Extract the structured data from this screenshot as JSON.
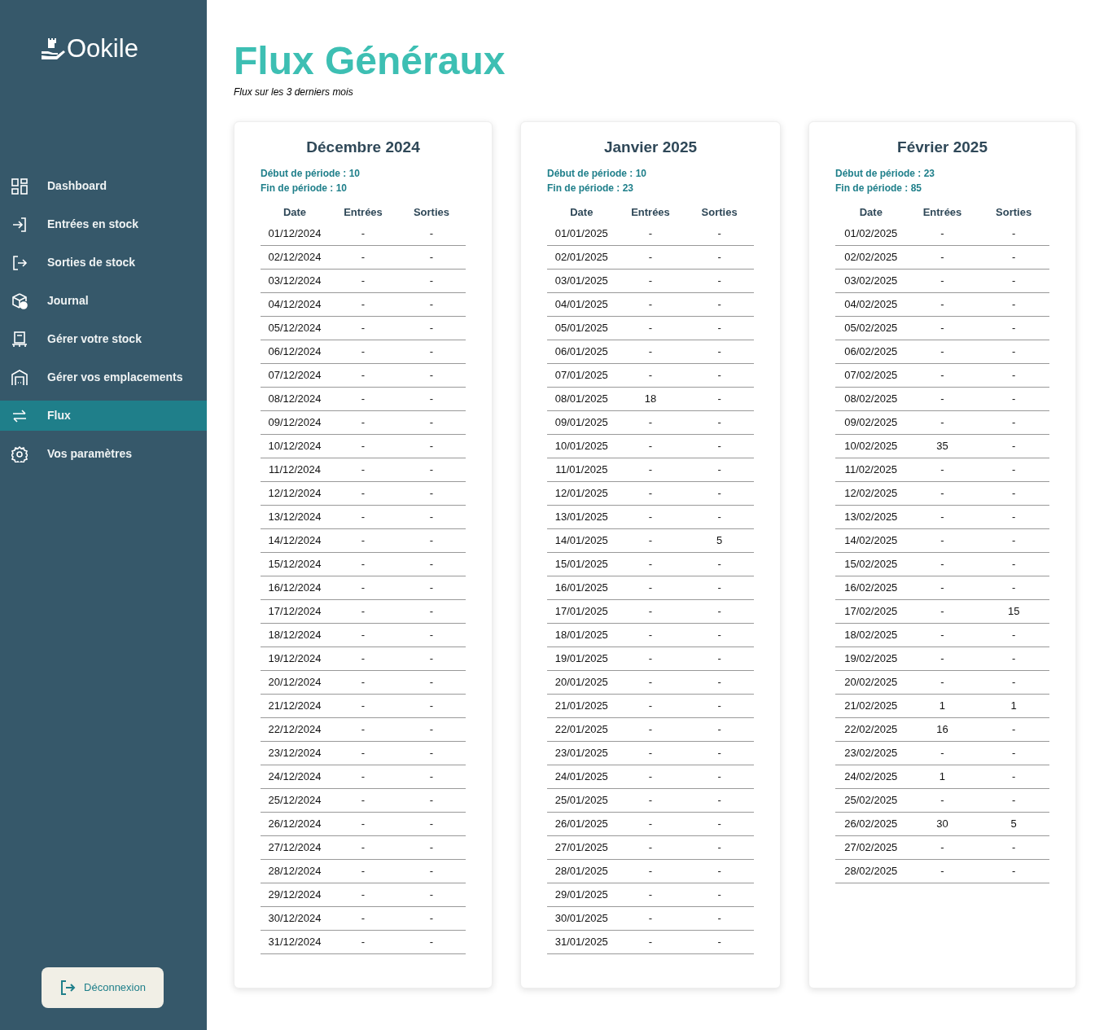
{
  "sidebar": {
    "logo": "Ookile",
    "items": [
      {
        "label": "Dashboard",
        "selected": false
      },
      {
        "label": "Entrées en stock",
        "selected": false
      },
      {
        "label": "Sorties de stock",
        "selected": false
      },
      {
        "label": "Journal",
        "selected": false
      },
      {
        "label": "Gérer votre stock",
        "selected": false
      },
      {
        "label": "Gérer vos emplacements",
        "selected": false
      },
      {
        "label": "Flux",
        "selected": true
      },
      {
        "label": "Vos paramètres",
        "selected": false
      }
    ],
    "logout": "Déconnexion"
  },
  "page": {
    "title": "Flux Généraux",
    "subtitle": "Flux sur les 3 derniers mois"
  },
  "months": [
    {
      "title": "Décembre 2024",
      "start": "Début de période : 10",
      "end": "Fin de période : 10",
      "columns": [
        "Date",
        "Entrées",
        "Sorties"
      ],
      "rows": [
        [
          "01/12/2024",
          "-",
          "-"
        ],
        [
          "02/12/2024",
          "-",
          "-"
        ],
        [
          "03/12/2024",
          "-",
          "-"
        ],
        [
          "04/12/2024",
          "-",
          "-"
        ],
        [
          "05/12/2024",
          "-",
          "-"
        ],
        [
          "06/12/2024",
          "-",
          "-"
        ],
        [
          "07/12/2024",
          "-",
          "-"
        ],
        [
          "08/12/2024",
          "-",
          "-"
        ],
        [
          "09/12/2024",
          "-",
          "-"
        ],
        [
          "10/12/2024",
          "-",
          "-"
        ],
        [
          "11/12/2024",
          "-",
          "-"
        ],
        [
          "12/12/2024",
          "-",
          "-"
        ],
        [
          "13/12/2024",
          "-",
          "-"
        ],
        [
          "14/12/2024",
          "-",
          "-"
        ],
        [
          "15/12/2024",
          "-",
          "-"
        ],
        [
          "16/12/2024",
          "-",
          "-"
        ],
        [
          "17/12/2024",
          "-",
          "-"
        ],
        [
          "18/12/2024",
          "-",
          "-"
        ],
        [
          "19/12/2024",
          "-",
          "-"
        ],
        [
          "20/12/2024",
          "-",
          "-"
        ],
        [
          "21/12/2024",
          "-",
          "-"
        ],
        [
          "22/12/2024",
          "-",
          "-"
        ],
        [
          "23/12/2024",
          "-",
          "-"
        ],
        [
          "24/12/2024",
          "-",
          "-"
        ],
        [
          "25/12/2024",
          "-",
          "-"
        ],
        [
          "26/12/2024",
          "-",
          "-"
        ],
        [
          "27/12/2024",
          "-",
          "-"
        ],
        [
          "28/12/2024",
          "-",
          "-"
        ],
        [
          "29/12/2024",
          "-",
          "-"
        ],
        [
          "30/12/2024",
          "-",
          "-"
        ],
        [
          "31/12/2024",
          "-",
          "-"
        ]
      ]
    },
    {
      "title": "Janvier 2025",
      "start": "Début de période : 10",
      "end": "Fin de période : 23",
      "columns": [
        "Date",
        "Entrées",
        "Sorties"
      ],
      "rows": [
        [
          "01/01/2025",
          "-",
          "-"
        ],
        [
          "02/01/2025",
          "-",
          "-"
        ],
        [
          "03/01/2025",
          "-",
          "-"
        ],
        [
          "04/01/2025",
          "-",
          "-"
        ],
        [
          "05/01/2025",
          "-",
          "-"
        ],
        [
          "06/01/2025",
          "-",
          "-"
        ],
        [
          "07/01/2025",
          "-",
          "-"
        ],
        [
          "08/01/2025",
          "18",
          "-"
        ],
        [
          "09/01/2025",
          "-",
          "-"
        ],
        [
          "10/01/2025",
          "-",
          "-"
        ],
        [
          "11/01/2025",
          "-",
          "-"
        ],
        [
          "12/01/2025",
          "-",
          "-"
        ],
        [
          "13/01/2025",
          "-",
          "-"
        ],
        [
          "14/01/2025",
          "-",
          "5"
        ],
        [
          "15/01/2025",
          "-",
          "-"
        ],
        [
          "16/01/2025",
          "-",
          "-"
        ],
        [
          "17/01/2025",
          "-",
          "-"
        ],
        [
          "18/01/2025",
          "-",
          "-"
        ],
        [
          "19/01/2025",
          "-",
          "-"
        ],
        [
          "20/01/2025",
          "-",
          "-"
        ],
        [
          "21/01/2025",
          "-",
          "-"
        ],
        [
          "22/01/2025",
          "-",
          "-"
        ],
        [
          "23/01/2025",
          "-",
          "-"
        ],
        [
          "24/01/2025",
          "-",
          "-"
        ],
        [
          "25/01/2025",
          "-",
          "-"
        ],
        [
          "26/01/2025",
          "-",
          "-"
        ],
        [
          "27/01/2025",
          "-",
          "-"
        ],
        [
          "28/01/2025",
          "-",
          "-"
        ],
        [
          "29/01/2025",
          "-",
          "-"
        ],
        [
          "30/01/2025",
          "-",
          "-"
        ],
        [
          "31/01/2025",
          "-",
          "-"
        ]
      ]
    },
    {
      "title": "Février 2025",
      "start": "Début de période : 23",
      "end": "Fin de période : 85",
      "columns": [
        "Date",
        "Entrées",
        "Sorties"
      ],
      "rows": [
        [
          "01/02/2025",
          "-",
          "-"
        ],
        [
          "02/02/2025",
          "-",
          "-"
        ],
        [
          "03/02/2025",
          "-",
          "-"
        ],
        [
          "04/02/2025",
          "-",
          "-"
        ],
        [
          "05/02/2025",
          "-",
          "-"
        ],
        [
          "06/02/2025",
          "-",
          "-"
        ],
        [
          "07/02/2025",
          "-",
          "-"
        ],
        [
          "08/02/2025",
          "-",
          "-"
        ],
        [
          "09/02/2025",
          "-",
          "-"
        ],
        [
          "10/02/2025",
          "35",
          "-"
        ],
        [
          "11/02/2025",
          "-",
          "-"
        ],
        [
          "12/02/2025",
          "-",
          "-"
        ],
        [
          "13/02/2025",
          "-",
          "-"
        ],
        [
          "14/02/2025",
          "-",
          "-"
        ],
        [
          "15/02/2025",
          "-",
          "-"
        ],
        [
          "16/02/2025",
          "-",
          "-"
        ],
        [
          "17/02/2025",
          "-",
          "15"
        ],
        [
          "18/02/2025",
          "-",
          "-"
        ],
        [
          "19/02/2025",
          "-",
          "-"
        ],
        [
          "20/02/2025",
          "-",
          "-"
        ],
        [
          "21/02/2025",
          "1",
          "1"
        ],
        [
          "22/02/2025",
          "16",
          "-"
        ],
        [
          "23/02/2025",
          "-",
          "-"
        ],
        [
          "24/02/2025",
          "1",
          "-"
        ],
        [
          "25/02/2025",
          "-",
          "-"
        ],
        [
          "26/02/2025",
          "30",
          "5"
        ],
        [
          "27/02/2025",
          "-",
          "-"
        ],
        [
          "28/02/2025",
          "-",
          "-"
        ]
      ]
    }
  ]
}
